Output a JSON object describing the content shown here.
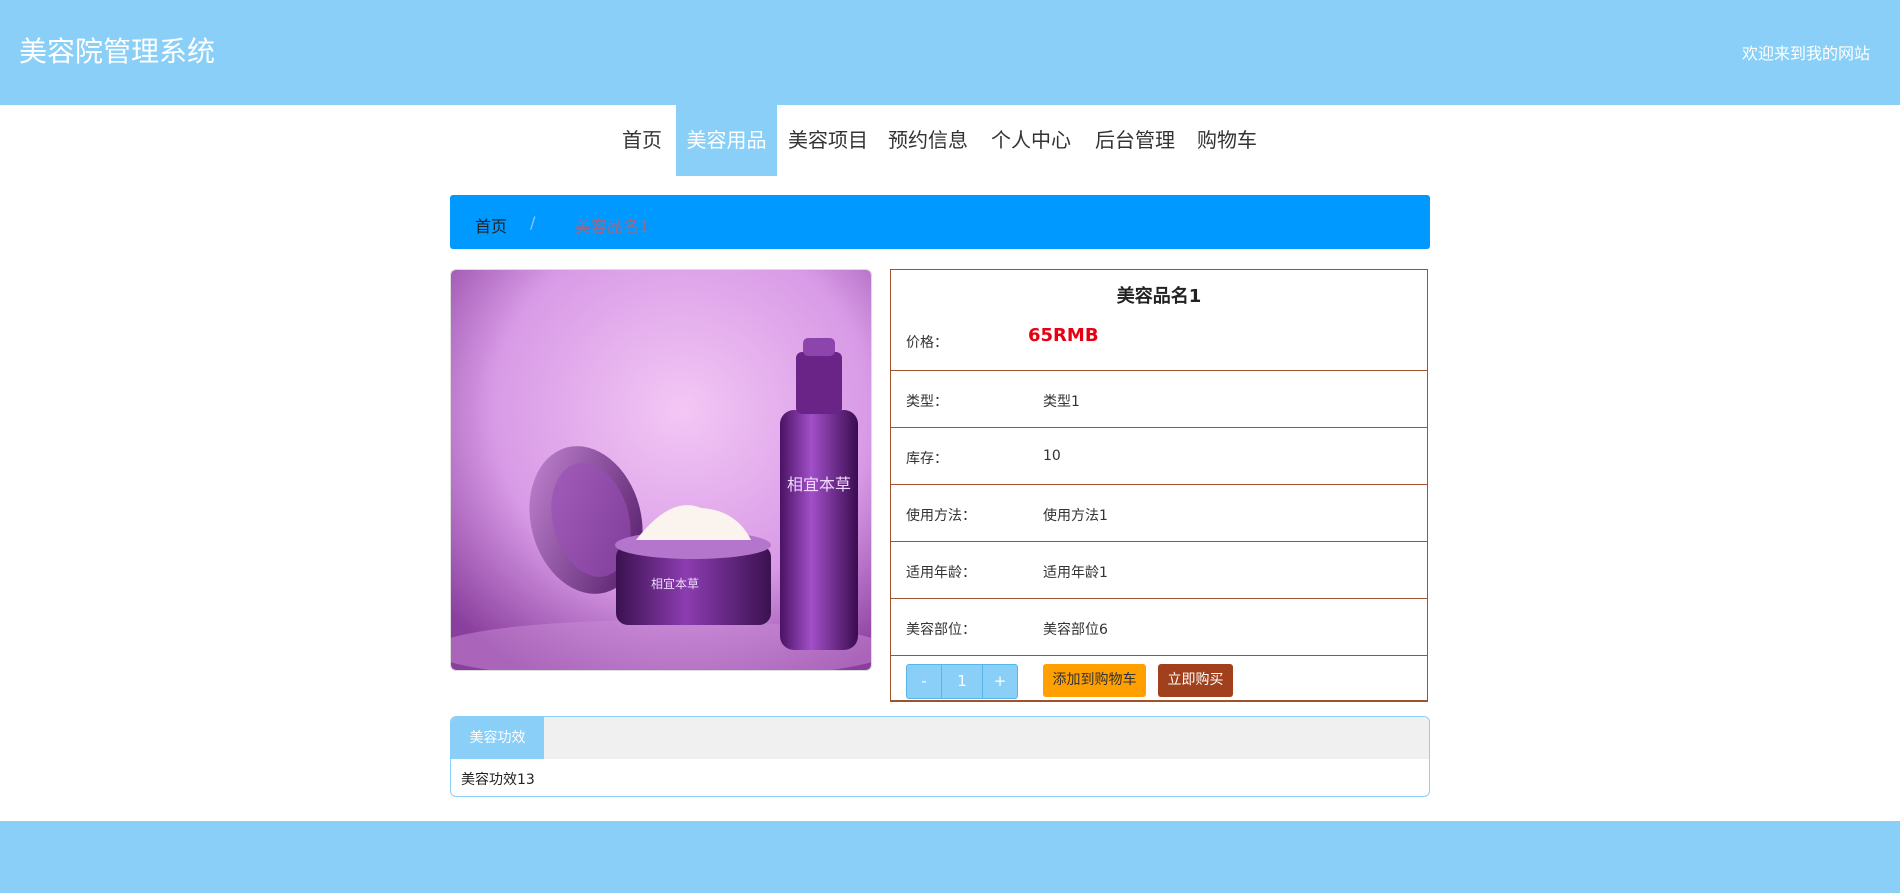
{
  "header": {
    "title": "美容院管理系统",
    "welcome": "欢迎来到我的网站"
  },
  "nav": {
    "items": [
      "首页",
      "美容用品",
      "美容项目",
      "预约信息",
      "个人中心",
      "后台管理",
      "购物车"
    ],
    "active": "美容用品"
  },
  "breadcrumb": {
    "home": "首页",
    "separator": "/",
    "current": "美容品名1"
  },
  "product": {
    "name": "美容品名1",
    "price_label": "价格：",
    "price": "65RMB",
    "rows": [
      {
        "label": "类型：",
        "value": "类型1"
      },
      {
        "label": "库存：",
        "value": "10"
      },
      {
        "label": "使用方法：",
        "value": "使用方法1"
      },
      {
        "label": "适用年龄：",
        "value": "适用年龄1"
      },
      {
        "label": "美容部位：",
        "value": "美容部位6"
      }
    ],
    "image_brand": "相宜本草"
  },
  "purchase": {
    "minus": "-",
    "quantity": "1",
    "plus": "+",
    "add_to_cart": "添加到购物车",
    "buy_now": "立即购买"
  },
  "tabs": {
    "active_label": "美容功效",
    "content": "美容功效13"
  },
  "colors": {
    "header": "#89cff8",
    "breadcrumb": "#0099ff",
    "price": "#e60012",
    "cart_button": "#ffa000",
    "buy_button": "#a0401c",
    "detail_border": "#a0522d"
  }
}
